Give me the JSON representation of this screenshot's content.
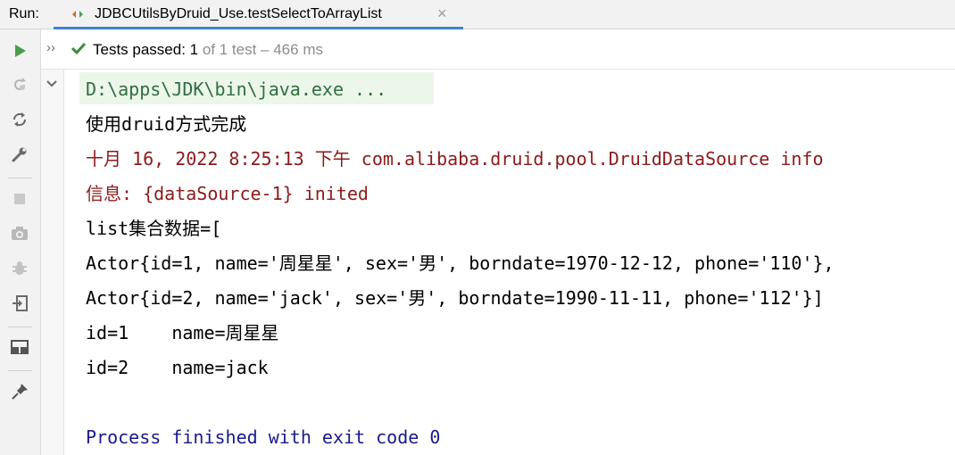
{
  "run_tab": {
    "run_label": "Run:",
    "title": "JDBCUtilsByDruid_Use.testSelectToArrayList"
  },
  "status": {
    "tests_passed_label": "Tests passed: 1",
    "detail": " of 1 test – 466 ms"
  },
  "toolbar": {
    "icons": [
      "run-icon",
      "rerun-failed-icon",
      "rerun-icon",
      "settings-wrench-icon",
      "stop-icon",
      "camera-icon",
      "debug-icon",
      "import-icon",
      "layout-icon",
      "pin-icon"
    ]
  },
  "console": {
    "lines": [
      "D:\\apps\\JDK\\bin\\java.exe ...",
      "使用druid方式完成",
      "十月 16, 2022 8:25:13 下午 com.alibaba.druid.pool.DruidDataSource info",
      "信息: {dataSource-1} inited",
      "list集合数据=[",
      "Actor{id=1, name='周星星', sex='男', borndate=1970-12-12, phone='110'},",
      "Actor{id=2, name='jack', sex='男', borndate=1990-11-11, phone='112'}]",
      "id=1    name=周星星",
      "id=2    name=jack",
      "",
      "Process finished with exit code 0"
    ]
  },
  "colors": {
    "command": "#2f6e40",
    "stdout": "#000000",
    "stderr": "#8c1a1a",
    "system": "#1a1a8c",
    "pass": "#3a8c3a",
    "tab_underline": "#4083c9"
  }
}
